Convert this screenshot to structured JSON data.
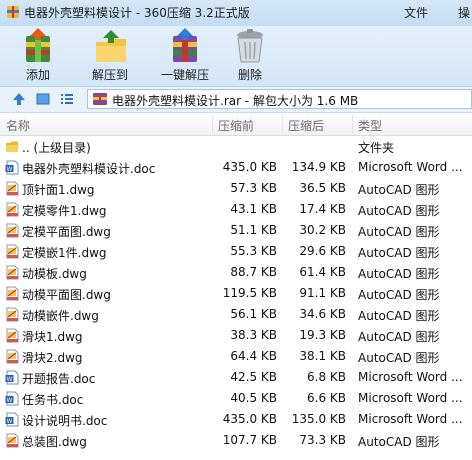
{
  "titlebar": {
    "title": "电器外壳塑料模设计 - 360压缩 3.2正式版",
    "menus": [
      "文件",
      "操"
    ]
  },
  "toolbar": {
    "buttons": [
      {
        "label": "添加",
        "icon": "add-archive-icon"
      },
      {
        "label": "解压到",
        "icon": "extract-folder-icon"
      },
      {
        "label": "一键解压",
        "icon": "one-click-extract-icon"
      },
      {
        "label": "删除",
        "icon": "trash-icon"
      }
    ]
  },
  "addressbar": {
    "path": "电器外壳塑料模设计.rar - 解包大小为 1.6 MB"
  },
  "columns": {
    "name": "名称",
    "size": "压缩前",
    "compressed": "压缩后",
    "type": "类型"
  },
  "files": [
    {
      "name": ".. (上级目录)",
      "size": "",
      "compressed": "",
      "type": "文件夹",
      "icon": "folder-up-icon"
    },
    {
      "name": "电器外壳塑料模设计.doc",
      "size": "435.0 KB",
      "compressed": "134.9 KB",
      "type": "Microsoft Word ...",
      "icon": "word-doc-icon"
    },
    {
      "name": "顶针面1.dwg",
      "size": "57.3 KB",
      "compressed": "36.5 KB",
      "type": "AutoCAD 图形",
      "icon": "dwg-file-icon"
    },
    {
      "name": "定模零件1.dwg",
      "size": "43.1 KB",
      "compressed": "17.4 KB",
      "type": "AutoCAD 图形",
      "icon": "dwg-file-icon"
    },
    {
      "name": "定模平面图.dwg",
      "size": "51.1 KB",
      "compressed": "30.2 KB",
      "type": "AutoCAD 图形",
      "icon": "dwg-file-icon"
    },
    {
      "name": "定模嵌1件.dwg",
      "size": "55.3 KB",
      "compressed": "29.6 KB",
      "type": "AutoCAD 图形",
      "icon": "dwg-file-icon"
    },
    {
      "name": "动模板.dwg",
      "size": "88.7 KB",
      "compressed": "61.4 KB",
      "type": "AutoCAD 图形",
      "icon": "dwg-file-icon"
    },
    {
      "name": "动模平面图.dwg",
      "size": "119.5 KB",
      "compressed": "91.1 KB",
      "type": "AutoCAD 图形",
      "icon": "dwg-file-icon"
    },
    {
      "name": "动模嵌件.dwg",
      "size": "56.1 KB",
      "compressed": "34.6 KB",
      "type": "AutoCAD 图形",
      "icon": "dwg-file-icon"
    },
    {
      "name": "滑块1.dwg",
      "size": "38.3 KB",
      "compressed": "19.3 KB",
      "type": "AutoCAD 图形",
      "icon": "dwg-file-icon"
    },
    {
      "name": "滑块2.dwg",
      "size": "64.4 KB",
      "compressed": "38.1 KB",
      "type": "AutoCAD 图形",
      "icon": "dwg-file-icon"
    },
    {
      "name": "开题报告.doc",
      "size": "42.5 KB",
      "compressed": "6.8 KB",
      "type": "Microsoft Word ...",
      "icon": "word-doc-icon"
    },
    {
      "name": "任务书.doc",
      "size": "40.5 KB",
      "compressed": "6.6 KB",
      "type": "Microsoft Word ...",
      "icon": "word-doc-icon"
    },
    {
      "name": "设计说明书.doc",
      "size": "435.0 KB",
      "compressed": "135.0 KB",
      "type": "Microsoft Word ...",
      "icon": "word-doc-icon"
    },
    {
      "name": "总装图.dwg",
      "size": "107.7 KB",
      "compressed": "73.3 KB",
      "type": "AutoCAD 图形",
      "icon": "dwg-file-icon"
    }
  ]
}
